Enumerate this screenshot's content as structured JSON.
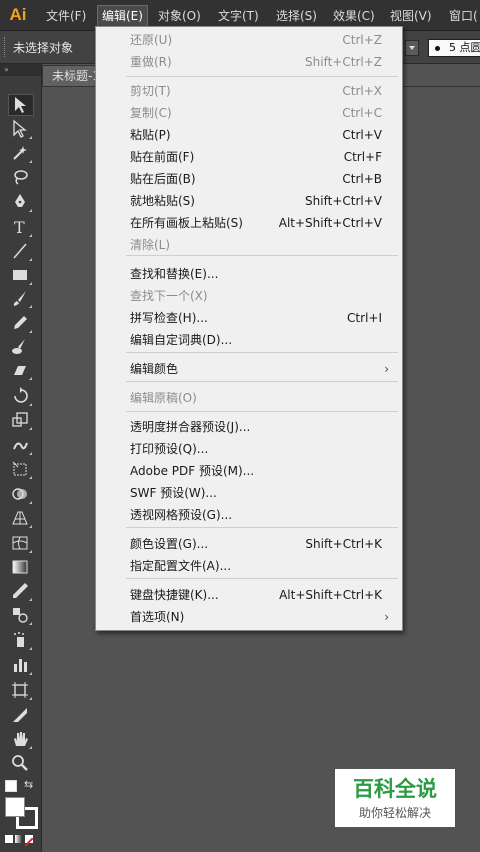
{
  "app": {
    "logo": "Ai"
  },
  "menubar": {
    "items": [
      "文件(F)",
      "编辑(E)",
      "对象(O)",
      "文字(T)",
      "选择(S)",
      "效果(C)",
      "视图(V)",
      "窗口("
    ],
    "active_index": 1
  },
  "controlbar": {
    "selection_status": "未选择对象",
    "stroke_value": "5 点圆"
  },
  "tools": {
    "panel_header": "»",
    "items": [
      "selection-tool",
      "direct-selection-tool",
      "magic-wand-tool",
      "lasso-tool",
      "pen-tool",
      "type-tool",
      "line-segment-tool",
      "rectangle-tool",
      "paintbrush-tool",
      "pencil-tool",
      "blob-brush-tool",
      "eraser-tool",
      "rotate-tool",
      "scale-tool",
      "warp-tool",
      "free-transform-tool",
      "shape-builder-tool",
      "perspective-grid-tool",
      "mesh-tool",
      "gradient-tool",
      "eyedropper-tool",
      "blend-tool",
      "symbol-sprayer-tool",
      "column-graph-tool",
      "artboard-tool",
      "slice-tool",
      "hand-tool",
      "zoom-tool"
    ]
  },
  "document": {
    "tab_title": "未标题-1"
  },
  "edit_menu": {
    "items": [
      {
        "label": "还原(U)",
        "shortcut": "Ctrl+Z",
        "disabled": true
      },
      {
        "label": "重做(R)",
        "shortcut": "Shift+Ctrl+Z",
        "disabled": true
      },
      {
        "label": "剪切(T)",
        "shortcut": "Ctrl+X",
        "disabled": true
      },
      {
        "label": "复制(C)",
        "shortcut": "Ctrl+C",
        "disabled": true
      },
      {
        "label": "粘贴(P)",
        "shortcut": "Ctrl+V",
        "disabled": false
      },
      {
        "label": "贴在前面(F)",
        "shortcut": "Ctrl+F",
        "disabled": false
      },
      {
        "label": "贴在后面(B)",
        "shortcut": "Ctrl+B",
        "disabled": false
      },
      {
        "label": "就地粘贴(S)",
        "shortcut": "Shift+Ctrl+V",
        "disabled": false
      },
      {
        "label": "在所有画板上粘贴(S)",
        "shortcut": "Alt+Shift+Ctrl+V",
        "disabled": false
      },
      {
        "label": "清除(L)",
        "shortcut": "",
        "disabled": true
      },
      {
        "label": "查找和替换(E)...",
        "shortcut": "",
        "disabled": false
      },
      {
        "label": "查找下一个(X)",
        "shortcut": "",
        "disabled": true
      },
      {
        "label": "拼写检查(H)...",
        "shortcut": "Ctrl+I",
        "disabled": false
      },
      {
        "label": "编辑自定词典(D)...",
        "shortcut": "",
        "disabled": false
      },
      {
        "label": "编辑颜色",
        "shortcut": "",
        "disabled": false,
        "submenu": true
      },
      {
        "label": "编辑原稿(O)",
        "shortcut": "",
        "disabled": true
      },
      {
        "label": "透明度拼合器预设(J)...",
        "shortcut": "",
        "disabled": false
      },
      {
        "label": "打印预设(Q)...",
        "shortcut": "",
        "disabled": false
      },
      {
        "label": "Adobe PDF 预设(M)...",
        "shortcut": "",
        "disabled": false
      },
      {
        "label": "SWF 预设(W)...",
        "shortcut": "",
        "disabled": false
      },
      {
        "label": "透视网格预设(G)...",
        "shortcut": "",
        "disabled": false
      },
      {
        "label": "颜色设置(G)...",
        "shortcut": "Shift+Ctrl+K",
        "disabled": false
      },
      {
        "label": "指定配置文件(A)...",
        "shortcut": "",
        "disabled": false
      },
      {
        "label": "键盘快捷键(K)...",
        "shortcut": "Alt+Shift+Ctrl+K",
        "disabled": false
      },
      {
        "label": "首选项(N)",
        "shortcut": "",
        "disabled": false,
        "submenu": true
      }
    ],
    "submenu_arrow": "›"
  },
  "watermark": {
    "title": "百科全说",
    "subtitle": "助你轻松解决"
  }
}
